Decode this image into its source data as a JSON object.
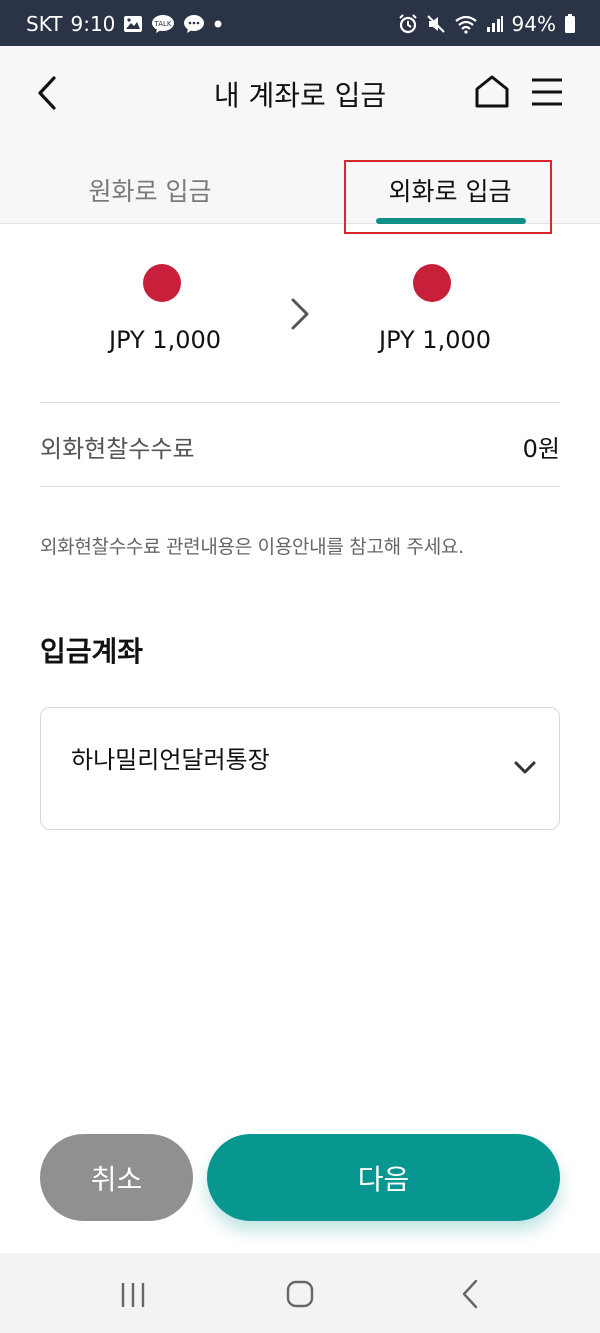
{
  "status_bar": {
    "carrier": "SKT",
    "time": "9:10",
    "talk_badge": "TALK",
    "battery": "94%"
  },
  "header": {
    "title": "내 계좌로 입금"
  },
  "tabs": [
    {
      "label": "원화로 입금",
      "active": false
    },
    {
      "label": "외화로 입금",
      "active": true
    }
  ],
  "exchange": {
    "from_amount": "JPY 1,000",
    "to_amount": "JPY 1,000"
  },
  "fee": {
    "label": "외화현찰수수료",
    "value": "0원"
  },
  "notice": "외화현찰수수료 관련내용은 이용안내를 참고해 주세요.",
  "deposit_account": {
    "section_title": "입금계좌",
    "selected": "하나밀리언달러통장"
  },
  "buttons": {
    "cancel": "취소",
    "next": "다음"
  },
  "colors": {
    "accent": "#079690",
    "flag_red": "#c8203a",
    "highlight_red": "#d9272e",
    "status_bar": "#2b3346"
  }
}
